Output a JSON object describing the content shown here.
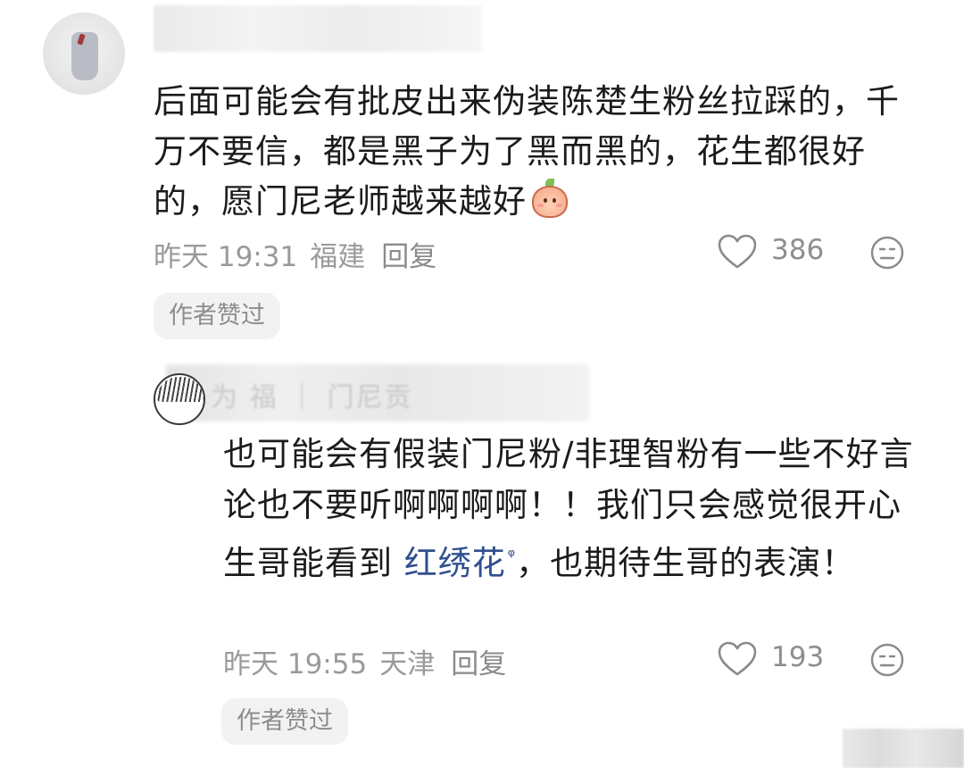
{
  "comments": [
    {
      "body": "后面可能会有批皮出来伪装陈楚生粉丝拉踩的，千万不要信，都是黑子为了黑而黑的，花生都很好的，愿门尼老师越来越好",
      "emoji": "peach-face-emoji",
      "time": "昨天 19:31",
      "location": "福建",
      "reply_label": "回复",
      "likes": "386",
      "badge": "作者赞过"
    },
    {
      "username_partial": "为 福 ｜ 门尼贡",
      "body_before_link": "也可能会有假装门尼粉/非理智粉有一些不好言论也不要听啊啊啊啊！！我们只会感觉很开心生哥能看到 ",
      "link_text": "红绣花",
      "link_mark": "ᵠ",
      "body_after_link": "，也期待生哥的表演！",
      "time": "昨天 19:55",
      "location": "天津",
      "reply_label": "回复",
      "likes": "193",
      "badge": "作者赞过"
    }
  ],
  "icons": {
    "like": "heart-outline-icon",
    "dislike": "neutral-face-icon"
  },
  "colors": {
    "text": "#1b1b1b",
    "meta": "#9a9a9a",
    "link": "#2f4f8f",
    "chip_bg": "#f2f2f2"
  }
}
